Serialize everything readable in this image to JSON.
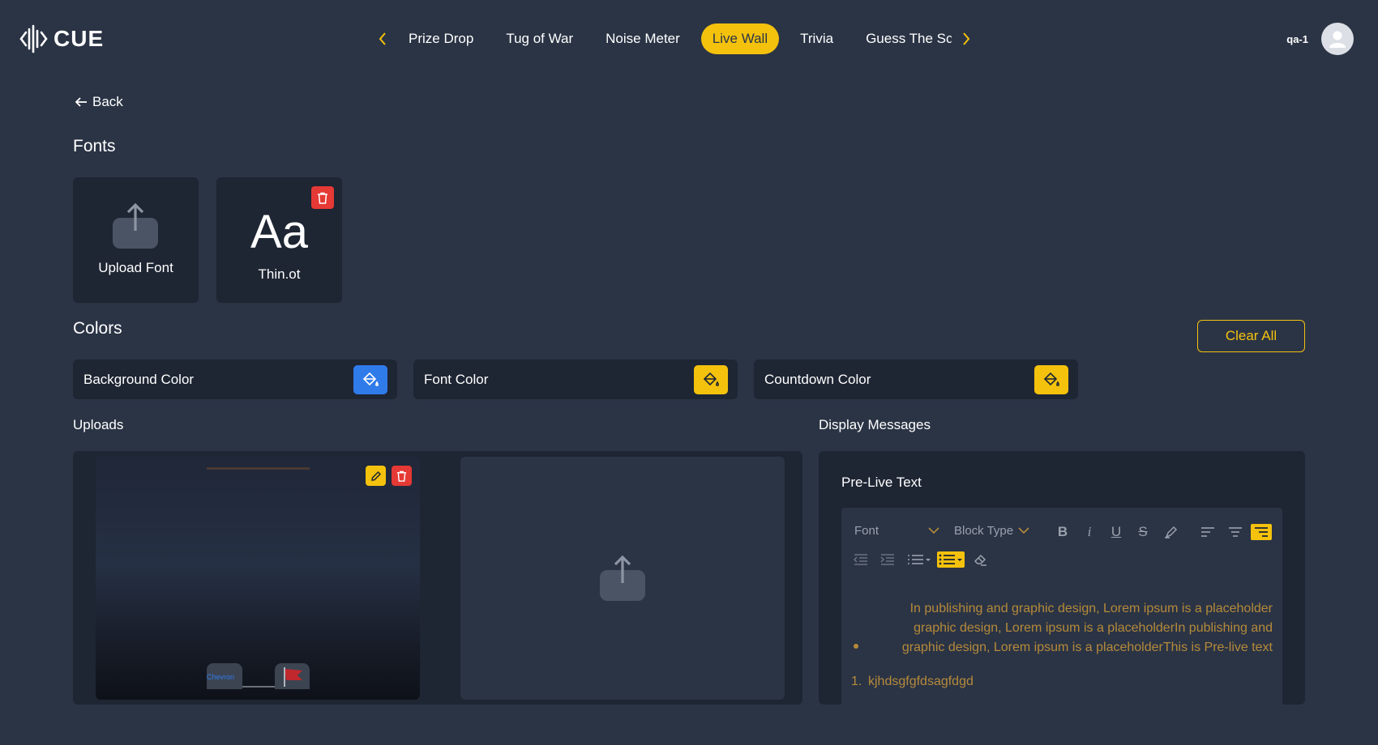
{
  "app": {
    "logo_text": "CUE"
  },
  "nav": {
    "items": [
      {
        "label": "Prize Drop"
      },
      {
        "label": "Tug of War"
      },
      {
        "label": "Noise Meter"
      },
      {
        "label": "Live Wall",
        "active": true
      },
      {
        "label": "Trivia"
      },
      {
        "label": "Guess The Sc"
      }
    ]
  },
  "user": {
    "name": "qa-1"
  },
  "page": {
    "back_label": "Back",
    "fonts_title": "Fonts",
    "upload_font_label": "Upload Font",
    "font_preview": "Aa",
    "font_file_name": "Thin.ot",
    "colors_title": "Colors",
    "clear_all_label": "Clear All",
    "colors": [
      {
        "label": "Background Color",
        "swatch": "#2f7bea"
      },
      {
        "label": "Font Color",
        "swatch": "#f4c20d"
      },
      {
        "label": "Countdown Color",
        "swatch": "#f4c20d"
      }
    ],
    "uploads_title": "Uploads",
    "display_messages_title": "Display Messages",
    "prelive_title": "Pre-Live Text",
    "editor": {
      "font_select": "Font",
      "block_type_select": "Block Type",
      "content_paragraph": "In publishing and graphic design, Lorem ipsum is a placeholder graphic design, Lorem ipsum is a placeholderIn publishing and graphic design, Lorem ipsum is a placeholderThis is Pre-live text",
      "ordered_item_marker": "1.",
      "ordered_item": "kjhdsgfgfdsagfdgd"
    },
    "upload_thumb_text": "Chevron"
  },
  "colors": {
    "accent": "#f4c20d",
    "danger": "#e53935",
    "background": "#2b3445",
    "panel": "#1e2533",
    "primary": "#2f7bea"
  }
}
